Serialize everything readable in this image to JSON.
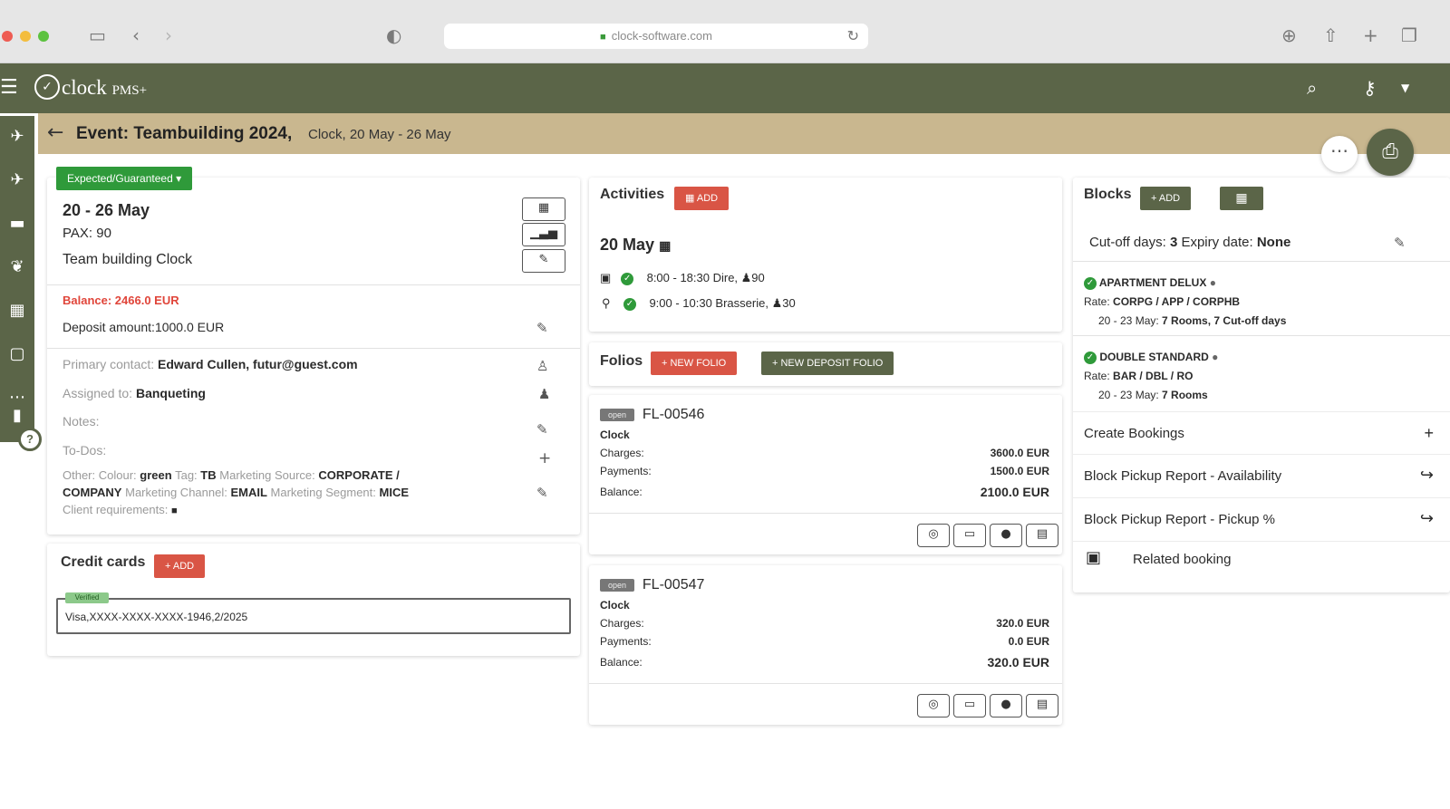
{
  "browser": {
    "url": "clock-software.com"
  },
  "app": {
    "logo": "clock",
    "logo_suffix": "PMS+"
  },
  "event": {
    "title": "Event: Teambuilding 2024,",
    "subtitle": "Clock, 20 May - 26 May"
  },
  "overview": {
    "status": "Expected/Guaranteed",
    "dates": "20 - 26 May",
    "pax": "PAX: 90",
    "name": "Team building Clock",
    "balance": "Balance: 2466.0 EUR",
    "deposit": "Deposit amount:1000.0 EUR",
    "primary_contact_label": "Primary contact:",
    "primary_contact_value": "Edward Cullen, futur@guest.com",
    "assigned_label": "Assigned to:",
    "assigned_value": "Banqueting",
    "notes_label": "Notes:",
    "todos_label": "To-Dos:",
    "other_label": "Other:",
    "colour_label": "Colour:",
    "colour_value": "green",
    "tag_label": "Tag:",
    "tag_value": "TB",
    "marketing_source_label": "Marketing Source:",
    "marketing_source_value": "CORPORATE /",
    "marketing_source_value2": "COMPANY",
    "marketing_channel_label": "Marketing Channel:",
    "marketing_channel_value": "EMAIL",
    "marketing_segment_label": "Marketing Segment:",
    "marketing_segment_value": "MICE",
    "client_req_label": "Client requirements:"
  },
  "credit_cards": {
    "title": "Credit cards",
    "add_label": "+ ADD",
    "verified": "Verified",
    "card_value": "Visa,XXXX-XXXX-XXXX-1946,2/2025"
  },
  "activities": {
    "title": "Activities",
    "add_label": "ADD",
    "date": "20 May",
    "items": [
      {
        "text": "8:00 - 18:30 Dire, ♟90"
      },
      {
        "text": "9:00 - 10:30 Brasserie, ♟30"
      }
    ]
  },
  "folios": {
    "title": "Folios",
    "new_folio": "+ NEW FOLIO",
    "new_deposit_folio": "+ NEW DEPOSIT FOLIO",
    "open_tag": "open",
    "charges_label": "Charges:",
    "payments_label": "Payments:",
    "balance_label": "Balance:",
    "items": [
      {
        "id": "FL-00546",
        "owner": "Clock",
        "charges": "3600.0 EUR",
        "payments": "1500.0 EUR",
        "balance": "2100.0 EUR"
      },
      {
        "id": "FL-00547",
        "owner": "Clock",
        "charges": "320.0 EUR",
        "payments": "0.0 EUR",
        "balance": "320.0 EUR"
      }
    ]
  },
  "blocks": {
    "title": "Blocks",
    "add_label": "+ ADD",
    "cutoff_label": "Cut-off days:",
    "cutoff_value": "3",
    "expiry_label": "Expiry date:",
    "expiry_value": "None",
    "rate_label": "Rate:",
    "items": [
      {
        "room": "APARTMENT DELUX",
        "rate": "CORPG / APP / CORPHB",
        "dates": "20 - 23 May:",
        "detail": "7 Rooms, 7 Cut-off days"
      },
      {
        "room": "DOUBLE STANDARD",
        "rate": "BAR / DBL / RO",
        "dates": "20 - 23 May:",
        "detail": "7 Rooms"
      }
    ],
    "links": [
      {
        "label": "Create Bookings",
        "icon": "+"
      },
      {
        "label": "Block Pickup Report - Availability",
        "icon": "↪"
      },
      {
        "label": "Block Pickup Report - Pickup %",
        "icon": "↪"
      }
    ],
    "related": "Related booking"
  }
}
